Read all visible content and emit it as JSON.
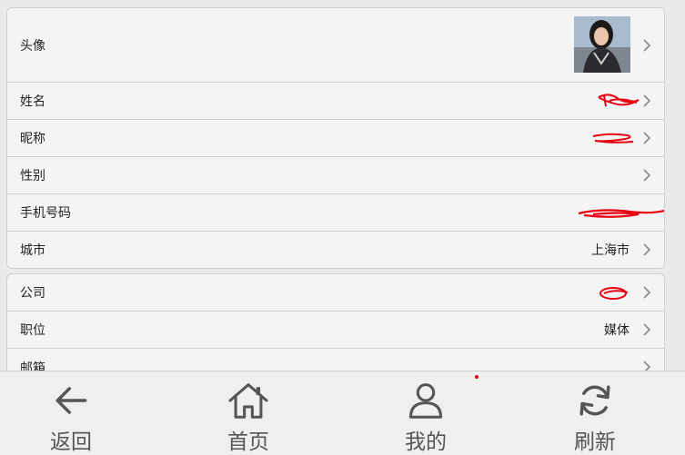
{
  "profile": {
    "avatar_label": "头像",
    "name_label": "姓名",
    "name_value": "",
    "nickname_label": "昵称",
    "nickname_value": "",
    "gender_label": "性别",
    "gender_value": "",
    "phone_label": "手机号码",
    "phone_value": "",
    "city_label": "城市",
    "city_value": "上海市"
  },
  "work": {
    "company_label": "公司",
    "company_value": "",
    "position_label": "职位",
    "position_value": "媒体",
    "email_label": "邮箱",
    "email_value": ""
  },
  "tabbar": {
    "back": "返回",
    "home": "首页",
    "mine": "我的",
    "refresh": "刷新"
  },
  "colors": {
    "redaction": "#e60012",
    "icon": "#555555"
  }
}
